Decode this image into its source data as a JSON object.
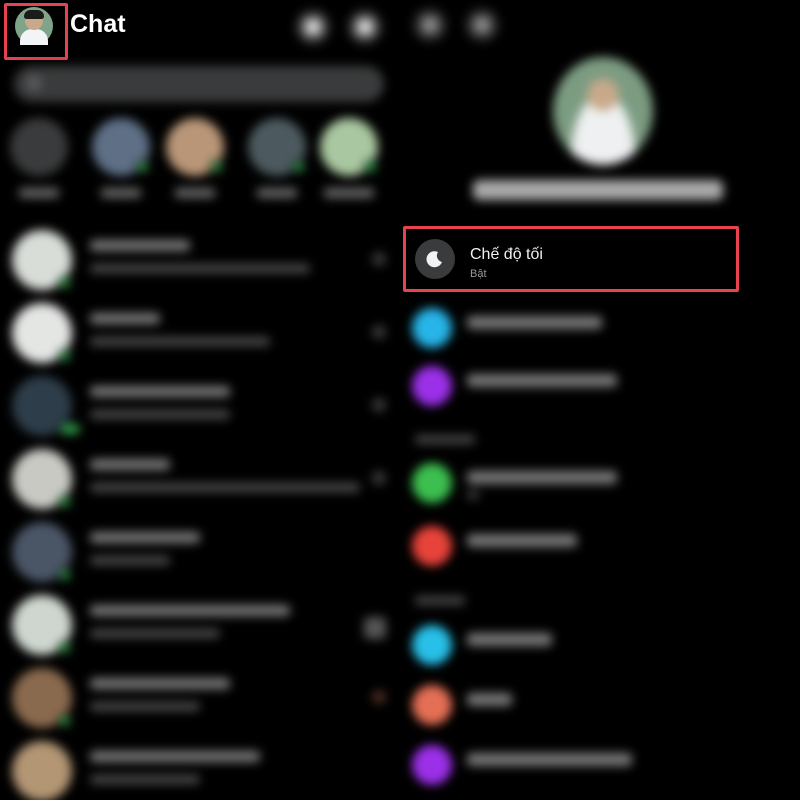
{
  "header": {
    "title": "Chat"
  },
  "settings": {
    "dark_mode": {
      "label": "Chế độ tối",
      "status": "Bật"
    }
  },
  "colors": {
    "background": "#000000",
    "highlight_box": "#e8414f",
    "online_dot": "#31a24c",
    "icon_circle": "#3a3b3c"
  },
  "icons": {
    "dark_mode": "moon-icon"
  }
}
